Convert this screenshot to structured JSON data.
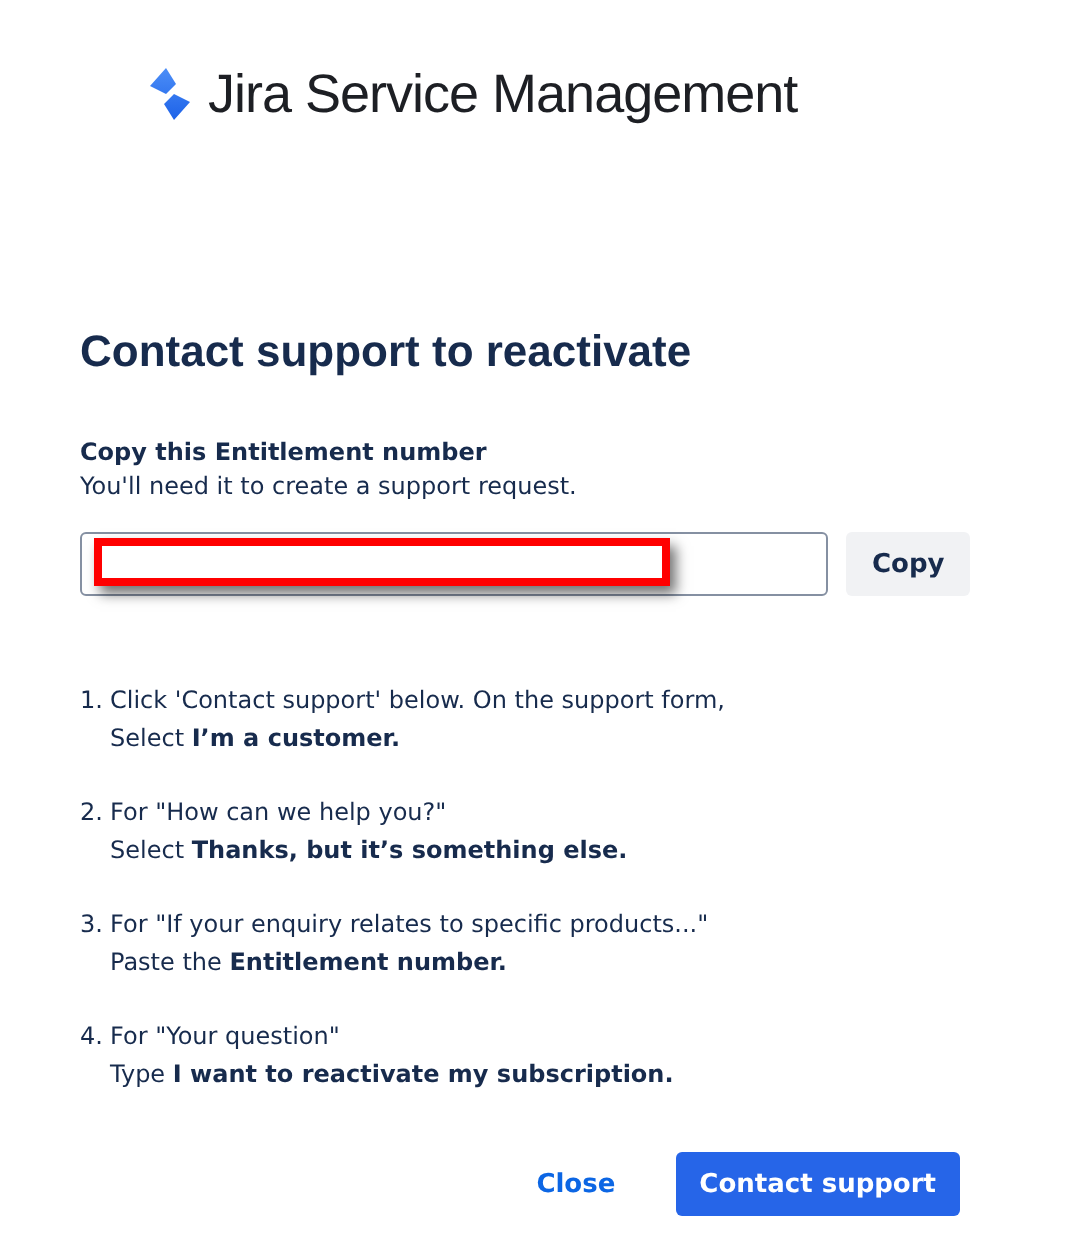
{
  "brand": {
    "name": "Jira Service Management"
  },
  "title": "Contact support to reactivate",
  "entitlement": {
    "label": "Copy this Entitlement number",
    "hint": "You'll need it to create a support request.",
    "redacted": true,
    "copy_button": "Copy"
  },
  "steps": [
    {
      "number": "1.",
      "line1": "Click 'Contact support' below. On the support form,",
      "line2": "Select **I’m a customer.**"
    },
    {
      "number": "2.",
      "line1": "For \"How can we help you?\"",
      "line2": "Select **Thanks, but it’s something else.**"
    },
    {
      "number": "3.",
      "line1": "For \"If your enquiry relates to specific products...\"",
      "line2": "Paste the **Entitlement number.**"
    },
    {
      "number": "4.",
      "line1": "For \"Your question\"",
      "line2": "Type **I want to reactivate my subscription.**"
    }
  ],
  "buttons": [
    {
      "label": "Close",
      "kind": "link"
    },
    {
      "label": "Contact support",
      "kind": "primary"
    }
  ]
}
